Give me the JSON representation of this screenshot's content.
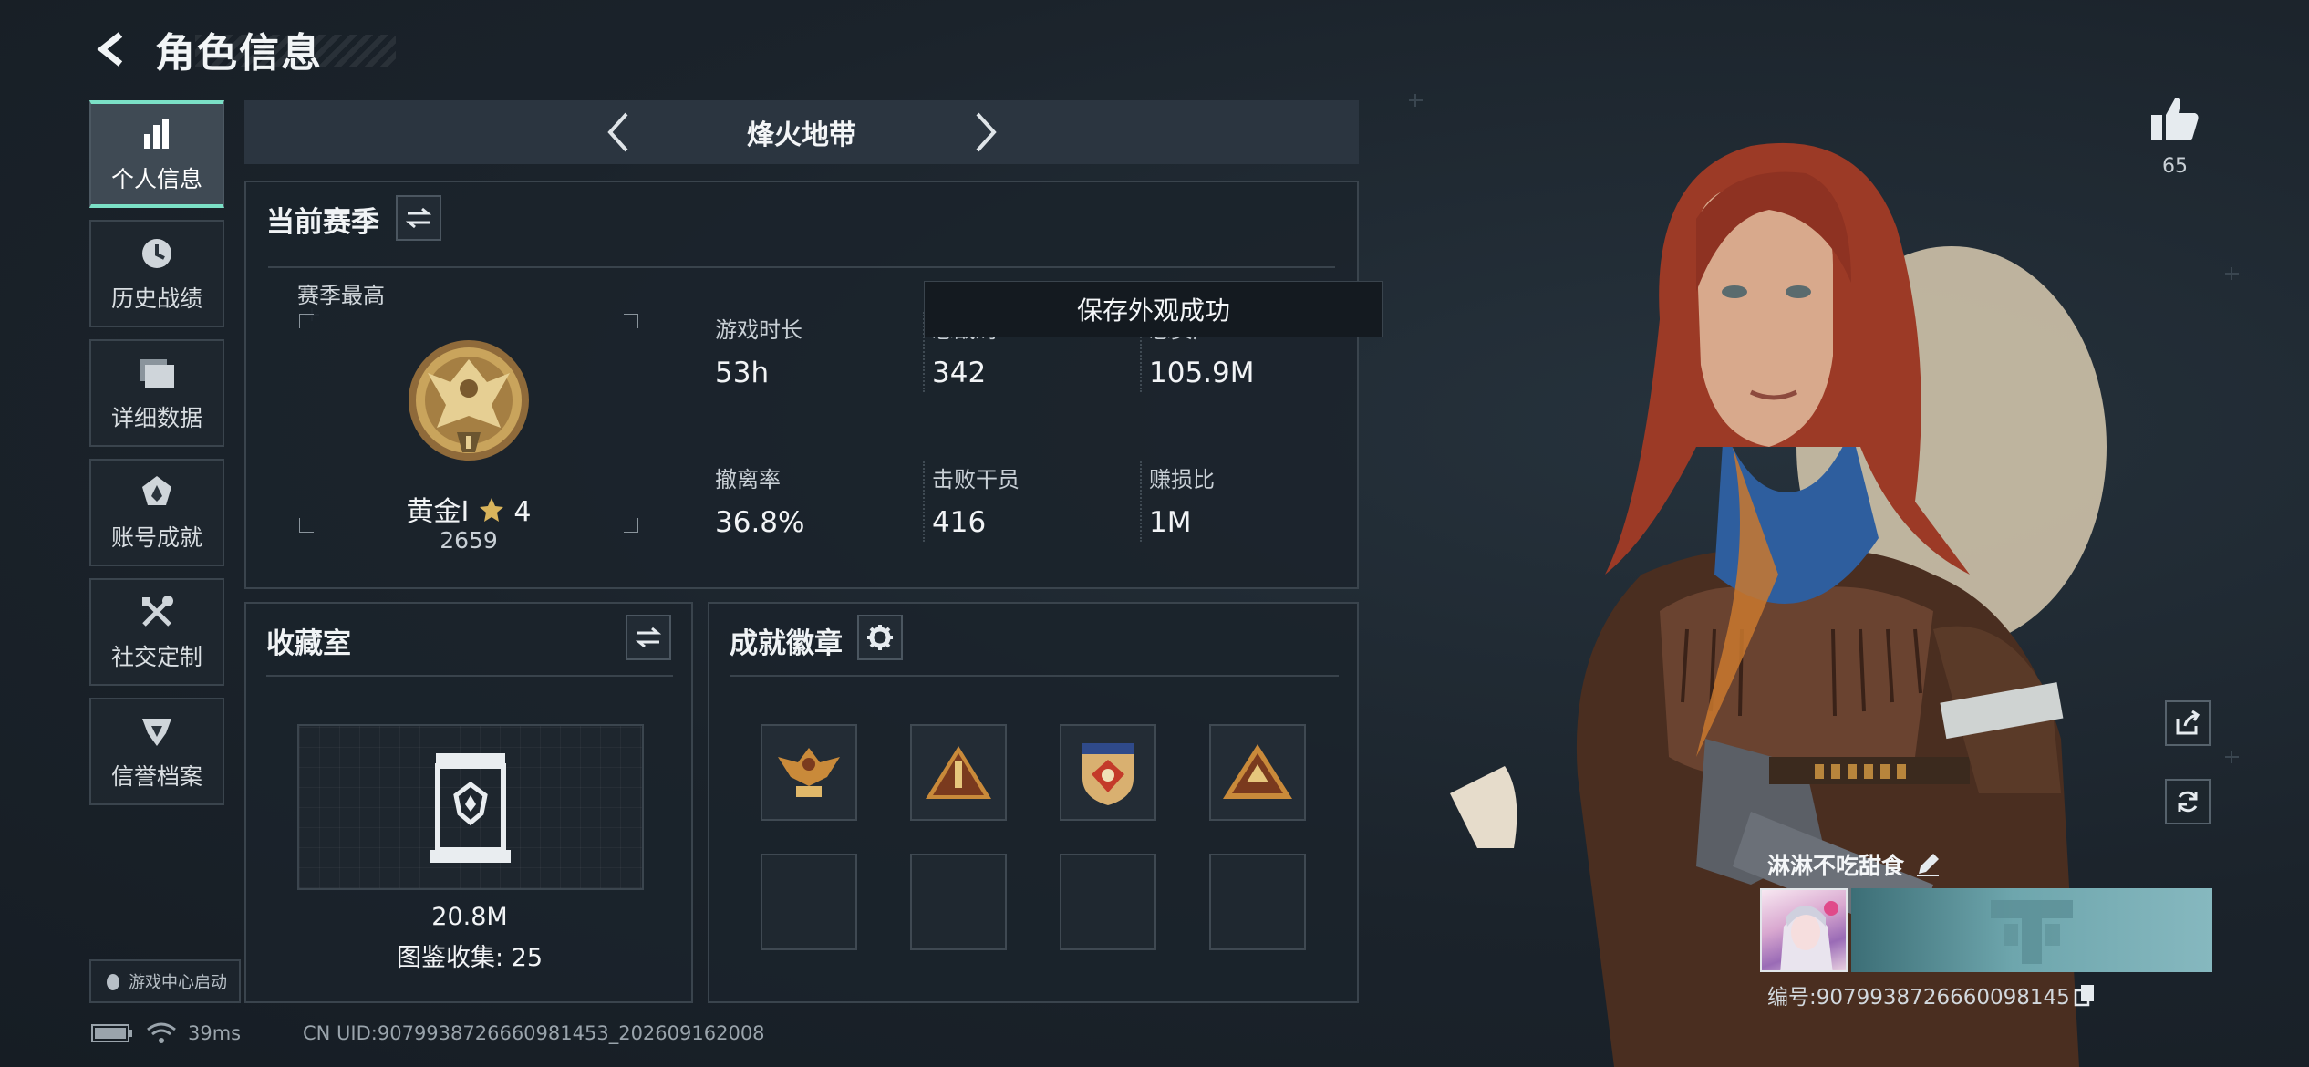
{
  "header": {
    "title": "角色信息"
  },
  "sidebar": {
    "items": [
      {
        "label": "个人信息",
        "icon": "bar-chart-icon",
        "active": true
      },
      {
        "label": "历史战绩",
        "icon": "clock-icon"
      },
      {
        "label": "详细数据",
        "icon": "folders-icon"
      },
      {
        "label": "账号成就",
        "icon": "achievement-icon"
      },
      {
        "label": "社交定制",
        "icon": "tools-icon"
      },
      {
        "label": "信誉档案",
        "icon": "credit-icon"
      }
    ],
    "launch_label": "游戏中心启动"
  },
  "mode": {
    "name": "烽火地带"
  },
  "season": {
    "title": "当前赛季",
    "best_label": "赛季最高",
    "rank_name": "黄金I",
    "rank_stars": "4",
    "rank_score": "2659",
    "stats": [
      {
        "label": "游戏时长",
        "value": "53h"
      },
      {
        "label": "总战局",
        "value": "342"
      },
      {
        "label": "总资产",
        "value": "105.9M"
      },
      {
        "label": "撤离率",
        "value": "36.8%"
      },
      {
        "label": "击败干员",
        "value": "416"
      },
      {
        "label": "赚损比",
        "value": "1M"
      }
    ]
  },
  "toast": {
    "message": "保存外观成功"
  },
  "collection": {
    "title": "收藏室",
    "value": "20.8M",
    "progress": "图鉴收集: 25"
  },
  "achievements": {
    "title": "成就徽章",
    "badges": [
      "eagle-badge-icon",
      "rocket-badge-icon",
      "shield-badge-icon",
      "triangle-badge-icon"
    ]
  },
  "profile": {
    "likes": "65",
    "player_name": "淋淋不吃甜食",
    "player_id": "编号:9079938726660098145"
  },
  "status": {
    "ping": "39ms",
    "uid": "CN UID:9079938726660981453_202609162008"
  },
  "colors": {
    "accent": "#7be0c6",
    "panel_border": "#3a444d",
    "gold": "#c9a45c"
  }
}
